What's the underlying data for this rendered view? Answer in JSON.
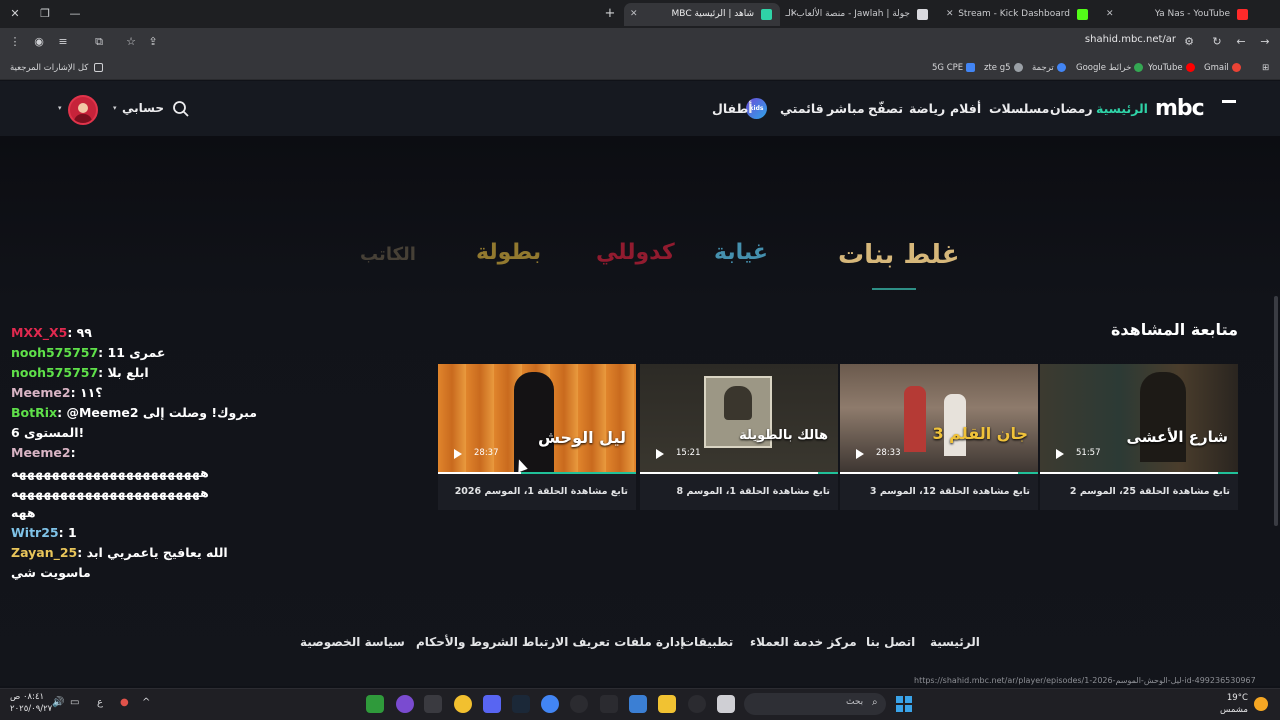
{
  "browser": {
    "tabs": [
      {
        "title": "Ya Nas - YouTube",
        "favicon": "youtube-icon",
        "active": false
      },
      {
        "title": "Stream - Kick Dashboard",
        "favicon": "kick-icon",
        "active": false
      },
      {
        "title": "جولة | Jawlah - منصة الألعاب الـ",
        "favicon": "jawlah-icon",
        "active": false
      },
      {
        "title": "شاهد | الرئيسية MBC",
        "favicon": "shahid-icon",
        "active": true
      }
    ],
    "url": "shahid.mbc.net/ar",
    "bookmarks": [
      {
        "label": "Gmail",
        "color": "#ea4335"
      },
      {
        "label": "YouTube",
        "color": "#ff0000"
      },
      {
        "label": "Google خرائط",
        "color": "#34a853"
      },
      {
        "label": "ترجمة",
        "color": "#4285f4"
      },
      {
        "label": "zte g5",
        "color": "#9aa0a6"
      },
      {
        "label": "5G CPE",
        "color": "#4285f4"
      }
    ],
    "all_bookmarks": "كل الإشارات المرجعية"
  },
  "header": {
    "logo": "mbc",
    "nav": [
      {
        "label": "الرئيسية",
        "active": true
      },
      {
        "label": "رمضان"
      },
      {
        "label": "مسلسلات"
      },
      {
        "label": "أفلام"
      },
      {
        "label": "رياضة"
      },
      {
        "label": "تصفّح"
      },
      {
        "label": "مباشر"
      },
      {
        "label": "قائمتي"
      },
      {
        "label": "أطفال"
      }
    ],
    "kids_badge": "kids",
    "account": "حسابي"
  },
  "hero": {
    "shows": [
      {
        "title": "غلط بنات",
        "color": "#d6b77a"
      },
      {
        "title": "غيابة",
        "color": "#4fa7c9"
      },
      {
        "title": "كدوللي",
        "color": "#c8203a"
      },
      {
        "title": "بطولة",
        "color": "#c9a53a"
      },
      {
        "title": "الكاتب",
        "color": "#8a7a5c"
      }
    ]
  },
  "continue_watching": {
    "title": "متابعة المشاهدة",
    "cards": [
      {
        "thumb_title": "شارع الأعشى",
        "duration": "51:57",
        "label": "تابع مشاهدة الحلقة 25، الموسم 2",
        "progress": 0.1,
        "bg": "#3a3226"
      },
      {
        "thumb_title": "جان القلم 3",
        "duration": "28:33",
        "label": "تابع مشاهدة الحلقة 12، الموسم 3",
        "progress": 0.1,
        "bg": "#5a4d44"
      },
      {
        "thumb_title": "هالك بالطويلة",
        "duration": "15:21",
        "label": "تابع مشاهدة الحلقة 1، الموسم 8",
        "progress": 0.1,
        "bg": "#3c3a33"
      },
      {
        "thumb_title": "ليل الوحش",
        "duration": "28:37",
        "label": "تابع مشاهدة الحلقة 1، الموسم 2026",
        "progress": 0.58,
        "bg": "#d4782a"
      }
    ]
  },
  "chat": {
    "lines": [
      {
        "user": "MXX_X5",
        "msg": "٩٩",
        "color": "#e0294f"
      },
      {
        "user": "nooh575757",
        "msg": "عمرى 11",
        "color": "#5fe04a"
      },
      {
        "user": "nooh575757",
        "msg": "ابلع بلا",
        "color": "#5fe04a"
      },
      {
        "user": "Meeme2",
        "msg": "؟١١",
        "color": "#d8b4c4"
      },
      {
        "user": "BotRix",
        "msg": "@Meeme2 مبروك! وصلت إلى",
        "color": "#5fe04a"
      },
      {
        "user": "",
        "msg": "المستوى 6!",
        "color": "#ffffff"
      },
      {
        "user": "Meeme2",
        "msg": "",
        "color": "#d8b4c4"
      },
      {
        "user": "",
        "msg": "هههههههههههههههههههههههه",
        "color": "#ffffff"
      },
      {
        "user": "",
        "msg": "هههههههههههههههههههههههه",
        "color": "#ffffff"
      },
      {
        "user": "",
        "msg": "ههه",
        "color": "#ffffff"
      },
      {
        "user": "Witr25",
        "msg": "1",
        "color": "#7fc3e8"
      },
      {
        "user": "Zayan_25",
        "msg": "الله يعافيج ياعمريي ابد",
        "color": "#e8c55a"
      },
      {
        "user": "",
        "msg": "ماسويت شي",
        "color": "#ffffff"
      }
    ]
  },
  "footer": {
    "links": [
      "الرئيسية",
      "اتصل بنا",
      "مركز خدمة العملاء",
      "تطبيقات",
      "إدارة ملفات تعريف الارتباط",
      "الشروط والأحكام",
      "سياسة الخصوصية"
    ],
    "status_url": "https://shahid.mbc.net/ar/player/episodes/1-ليل-الوحش-الموسم-2026-id-499236530967"
  },
  "taskbar": {
    "search_label": "بحث",
    "time": "٠٨:٤١ ص",
    "date": "٢٠٢٥/٠٩/٢٧",
    "lang": "ع",
    "temp": "19°C",
    "weather": "مشمس"
  }
}
